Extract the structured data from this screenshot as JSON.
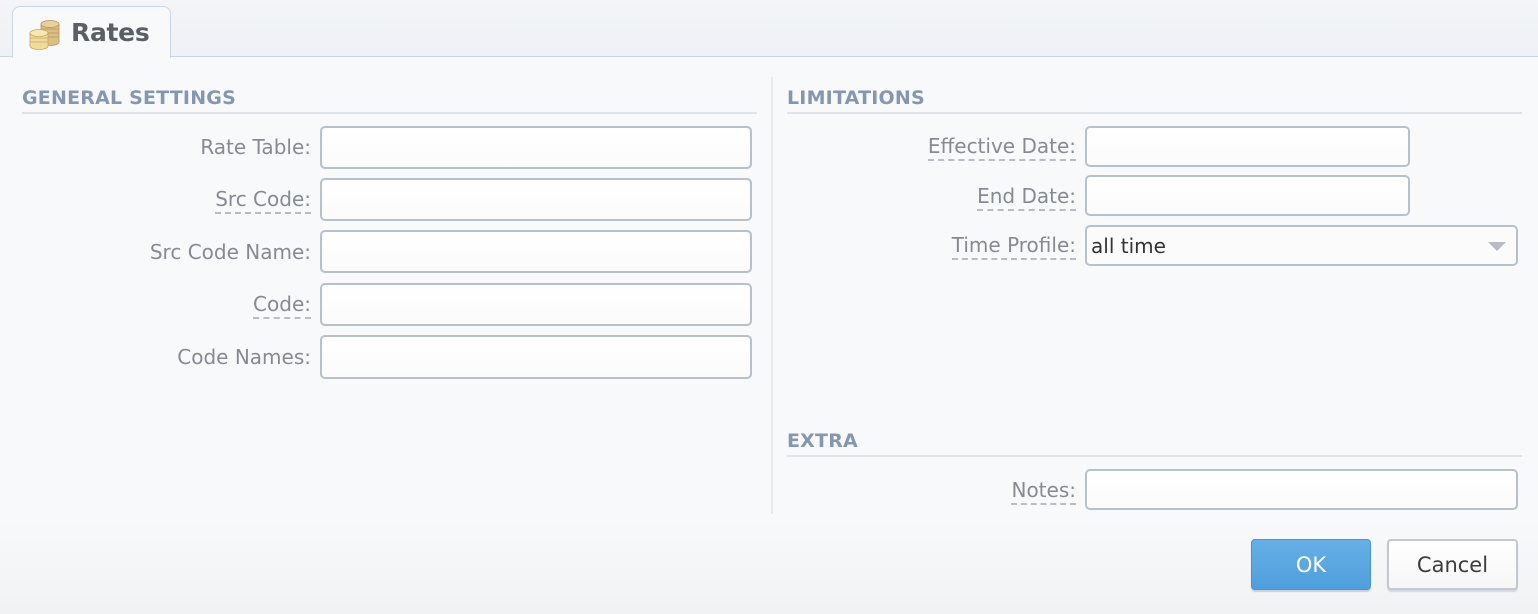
{
  "tab": {
    "label": "Rates",
    "icon": "coins-icon"
  },
  "general_settings": {
    "title": "GENERAL SETTINGS",
    "fields": [
      {
        "label": "Rate Table:",
        "value": "",
        "dashed": false
      },
      {
        "label": "Src Code:",
        "value": "",
        "dashed": true
      },
      {
        "label": "Src Code Name:",
        "value": "",
        "dashed": false
      },
      {
        "label": "Code:",
        "value": "",
        "dashed": true
      },
      {
        "label": "Code Names:",
        "value": "",
        "dashed": false
      }
    ]
  },
  "limitations": {
    "title": "LIMITATIONS",
    "effective_date": {
      "label": "Effective Date:",
      "value": ""
    },
    "end_date": {
      "label": "End Date:",
      "value": ""
    },
    "time_profile": {
      "label": "Time Profile:",
      "selected": "all time"
    }
  },
  "extra": {
    "title": "EXTRA",
    "notes": {
      "label": "Notes:",
      "value": ""
    }
  },
  "buttons": {
    "ok": "OK",
    "cancel": "Cancel"
  },
  "colors": {
    "accent": "#56a5e0",
    "section_title": "#8597b0",
    "label": "#868b93"
  }
}
